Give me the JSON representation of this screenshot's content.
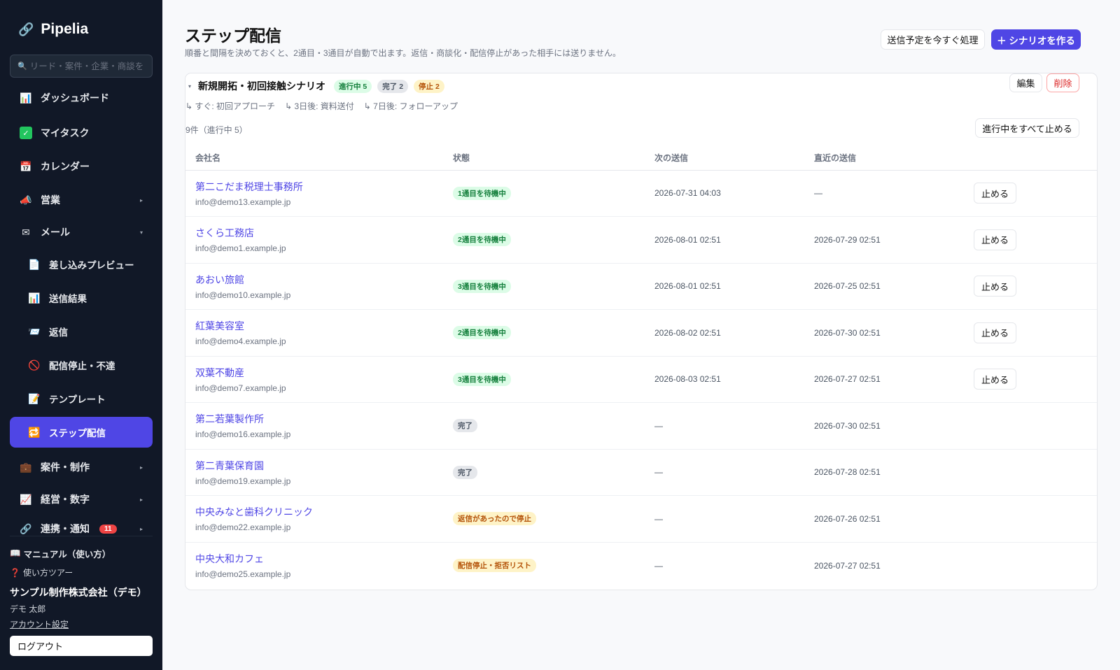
{
  "app": {
    "name": "Pipelia"
  },
  "search": {
    "placeholder": "リード・案件・企業・商談を"
  },
  "sidebar": {
    "items": [
      {
        "label": "ダッシュボード"
      },
      {
        "label": "マイタスク"
      },
      {
        "label": "カレンダー"
      },
      {
        "label": "営業"
      },
      {
        "label": "メール"
      },
      {
        "label": "差し込みプレビュー"
      },
      {
        "label": "送信結果"
      },
      {
        "label": "返信"
      },
      {
        "label": "配信停止・不達"
      },
      {
        "label": "テンプレート"
      },
      {
        "label": "ステップ配信"
      },
      {
        "label": "案件・制作"
      },
      {
        "label": "経営・数字"
      },
      {
        "label": "連携・通知",
        "badge": "11"
      }
    ],
    "manual": "マニュアル（使い方）",
    "tour": "使い方ツアー",
    "company": "サンプル制作株式会社（デモ）",
    "user": "デモ 太郎",
    "account": "アカウント設定",
    "logout": "ログアウト"
  },
  "header": {
    "title": "ステップ配信",
    "description": "順番と間隔を決めておくと、2通目・3通目が自動で出ます。返信・商談化・配信停止があった相手には送りません。",
    "process_now": "送信予定を今すぐ処理",
    "create": "＋ シナリオを作る"
  },
  "scenario": {
    "title": "新規開拓・初回接触シナリオ",
    "badges": {
      "active": "進行中 5",
      "done": "完了 2",
      "stopped": "停止 2"
    },
    "edit": "編集",
    "delete": "削除",
    "steps": [
      "↳ すぐ: 初回アプローチ",
      "↳ 3日後: 資料送付",
      "↳ 7日後: フォローアップ"
    ],
    "count": "9件（進行中 5）",
    "stop_all": "進行中をすべて止める"
  },
  "table": {
    "headers": [
      "会社名",
      "状態",
      "次の送信",
      "直近の送信",
      ""
    ],
    "stop_label": "止める",
    "rows": [
      {
        "company": "第二こだま税理士事務所",
        "email": "info@demo13.example.jp",
        "status": "1通目を待機中",
        "tone": "green",
        "next": "2026-07-31 04:03",
        "last": "—",
        "stoppable": true
      },
      {
        "company": "さくら工務店",
        "email": "info@demo1.example.jp",
        "status": "2通目を待機中",
        "tone": "green",
        "next": "2026-08-01 02:51",
        "last": "2026-07-29 02:51",
        "stoppable": true
      },
      {
        "company": "あおい旅館",
        "email": "info@demo10.example.jp",
        "status": "3通目を待機中",
        "tone": "green",
        "next": "2026-08-01 02:51",
        "last": "2026-07-25 02:51",
        "stoppable": true
      },
      {
        "company": "紅葉美容室",
        "email": "info@demo4.example.jp",
        "status": "2通目を待機中",
        "tone": "green",
        "next": "2026-08-02 02:51",
        "last": "2026-07-30 02:51",
        "stoppable": true
      },
      {
        "company": "双葉不動産",
        "email": "info@demo7.example.jp",
        "status": "3通目を待機中",
        "tone": "green",
        "next": "2026-08-03 02:51",
        "last": "2026-07-27 02:51",
        "stoppable": true
      },
      {
        "company": "第二若葉製作所",
        "email": "info@demo16.example.jp",
        "status": "完了",
        "tone": "gray",
        "next": "—",
        "last": "2026-07-30 02:51",
        "stoppable": false
      },
      {
        "company": "第二青葉保育園",
        "email": "info@demo19.example.jp",
        "status": "完了",
        "tone": "gray",
        "next": "—",
        "last": "2026-07-28 02:51",
        "stoppable": false
      },
      {
        "company": "中央みなと歯科クリニック",
        "email": "info@demo22.example.jp",
        "status": "返信があったので停止",
        "tone": "amber",
        "next": "—",
        "last": "2026-07-26 02:51",
        "stoppable": false
      },
      {
        "company": "中央大和カフェ",
        "email": "info@demo25.example.jp",
        "status": "配信停止・拒否リスト",
        "tone": "amber",
        "next": "—",
        "last": "2026-07-27 02:51",
        "stoppable": false
      }
    ]
  }
}
